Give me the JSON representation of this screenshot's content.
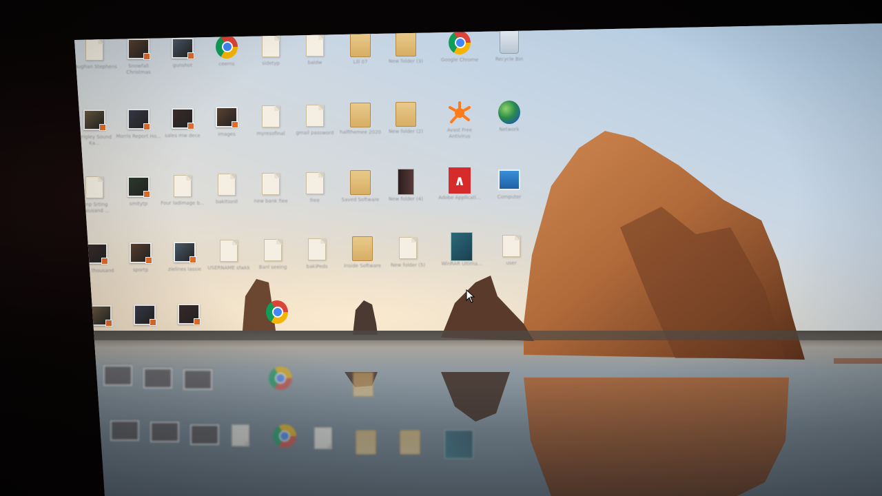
{
  "desktop": {
    "wallpaper": "haystack-rock-beach",
    "icons": [
      {
        "name": "doc-icon-1",
        "kind": "doc",
        "label": "Vaughan Stephens",
        "col": 0,
        "row": 0
      },
      {
        "name": "video-thumb-icon-1",
        "kind": "thumb",
        "label": "Snowfall Christmas",
        "col": 1,
        "row": 0
      },
      {
        "name": "video-thumb-icon-2",
        "kind": "thumb",
        "label": "gunshot",
        "col": 2,
        "row": 0
      },
      {
        "name": "chrome-icon-1",
        "kind": "chrome",
        "label": "ceerns",
        "col": 3,
        "row": 0
      },
      {
        "name": "doc-icon-2",
        "kind": "doc",
        "label": "sidetyp",
        "col": 4,
        "row": 0
      },
      {
        "name": "doc-icon-3",
        "kind": "doc",
        "label": "baldw",
        "col": 5,
        "row": 0
      },
      {
        "name": "folder-icon-1",
        "kind": "folder",
        "label": "Lill 07",
        "col": 6,
        "row": 0
      },
      {
        "name": "folder-icon-2",
        "kind": "folder",
        "label": "New folder (3)",
        "col": 7,
        "row": 0
      },
      {
        "name": "chrome-icon-2",
        "kind": "chrome",
        "label": "Google Chrome",
        "col": 8,
        "row": 0
      },
      {
        "name": "recycle-bin-icon",
        "kind": "bin",
        "label": "Recycle Bin",
        "col": 9,
        "row": 0
      },
      {
        "name": "video-thumb-icon-3",
        "kind": "thumb",
        "label": "Wrigley Sound Ka...",
        "col": 0,
        "row": 1
      },
      {
        "name": "video-thumb-icon-4",
        "kind": "thumb",
        "label": "Morris Report Ho...",
        "col": 1,
        "row": 1
      },
      {
        "name": "video-thumb-icon-5",
        "kind": "thumb",
        "label": "sales mw dece",
        "col": 2,
        "row": 1
      },
      {
        "name": "image-thumb-icon-1",
        "kind": "thumb",
        "label": "images",
        "col": 3,
        "row": 1
      },
      {
        "name": "doc-icon-4",
        "kind": "doc",
        "label": "myresofinal",
        "col": 4,
        "row": 1
      },
      {
        "name": "doc-icon-5",
        "kind": "doc",
        "label": "gmail password",
        "col": 5,
        "row": 1
      },
      {
        "name": "folder-icon-3",
        "kind": "folder",
        "label": "halfthemee 2020",
        "col": 6,
        "row": 1
      },
      {
        "name": "folder-icon-4",
        "kind": "folder",
        "label": "New folder (2)",
        "col": 7,
        "row": 1
      },
      {
        "name": "avast-icon",
        "kind": "avast",
        "label": "Avast Free Antivirus",
        "col": 8,
        "row": 1
      },
      {
        "name": "network-globe-icon",
        "kind": "globe",
        "label": "Network",
        "col": 9,
        "row": 1
      },
      {
        "name": "doc-icon-6",
        "kind": "doc",
        "label": "Smp Srting Thousand ...",
        "col": 0,
        "row": 2
      },
      {
        "name": "video-thumb-icon-6",
        "kind": "thumb",
        "label": "smitytp",
        "col": 1,
        "row": 2
      },
      {
        "name": "doc-icon-7",
        "kind": "doc",
        "label": "Four ladimage b...",
        "col": 2,
        "row": 2
      },
      {
        "name": "doc-icon-8",
        "kind": "doc",
        "label": "bakitionll",
        "col": 3,
        "row": 2
      },
      {
        "name": "doc-icon-9",
        "kind": "doc",
        "label": "new bank fiee",
        "col": 4,
        "row": 2
      },
      {
        "name": "doc-icon-10",
        "kind": "doc",
        "label": "free",
        "col": 5,
        "row": 2
      },
      {
        "name": "folder-icon-5",
        "kind": "folder",
        "label": "Saved Software",
        "col": 6,
        "row": 2
      },
      {
        "name": "book-icon",
        "kind": "book",
        "label": "New folder (4)",
        "col": 7,
        "row": 2
      },
      {
        "name": "adobe-icon",
        "kind": "adobe",
        "label": "Adobe Applicati...",
        "col": 8,
        "row": 2
      },
      {
        "name": "computer-icon",
        "kind": "computer",
        "label": "Computer",
        "col": 9,
        "row": 2
      },
      {
        "name": "video-thumb-icon-7",
        "kind": "thumb",
        "label": "stills thousand",
        "col": 0,
        "row": 3
      },
      {
        "name": "video-thumb-icon-8",
        "kind": "thumb",
        "label": "sportp",
        "col": 1,
        "row": 3
      },
      {
        "name": "video-thumb-icon-9",
        "kind": "thumb",
        "label": "zielines lassie",
        "col": 2,
        "row": 3
      },
      {
        "name": "doc-icon-11",
        "kind": "doc",
        "label": "USERNAME sfwkk",
        "col": 3,
        "row": 3
      },
      {
        "name": "doc-icon-12",
        "kind": "doc",
        "label": "Banl seeing",
        "col": 4,
        "row": 3
      },
      {
        "name": "doc-icon-13",
        "kind": "doc",
        "label": "bakiPeds",
        "col": 5,
        "row": 3
      },
      {
        "name": "folder-icon-6",
        "kind": "folder",
        "label": "Inside Software",
        "col": 6,
        "row": 3
      },
      {
        "name": "doc-icon-14",
        "kind": "doc",
        "label": "New folder (5)",
        "col": 7,
        "row": 3
      },
      {
        "name": "app-icon-1",
        "kind": "app",
        "label": "WinRAR Ultima...",
        "col": 8,
        "row": 3
      },
      {
        "name": "user-folder-icon",
        "kind": "doc",
        "label": "user",
        "col": 9,
        "row": 3
      },
      {
        "name": "video-thumb-icon-10",
        "kind": "thumb",
        "label": "",
        "col": 0,
        "row": 4
      },
      {
        "name": "video-thumb-icon-11",
        "kind": "thumb",
        "label": "",
        "col": 1,
        "row": 4
      },
      {
        "name": "video-thumb-icon-12",
        "kind": "thumb",
        "label": "",
        "col": 2,
        "row": 4
      },
      {
        "name": "chrome-icon-3",
        "kind": "chrome",
        "label": "",
        "col": 4,
        "row": 4
      }
    ]
  },
  "colors": {
    "rock": "#b06a3a",
    "rock_shadow": "#6a3a20",
    "sky_top": "#a8c6e0",
    "water": "#6c7a85"
  }
}
